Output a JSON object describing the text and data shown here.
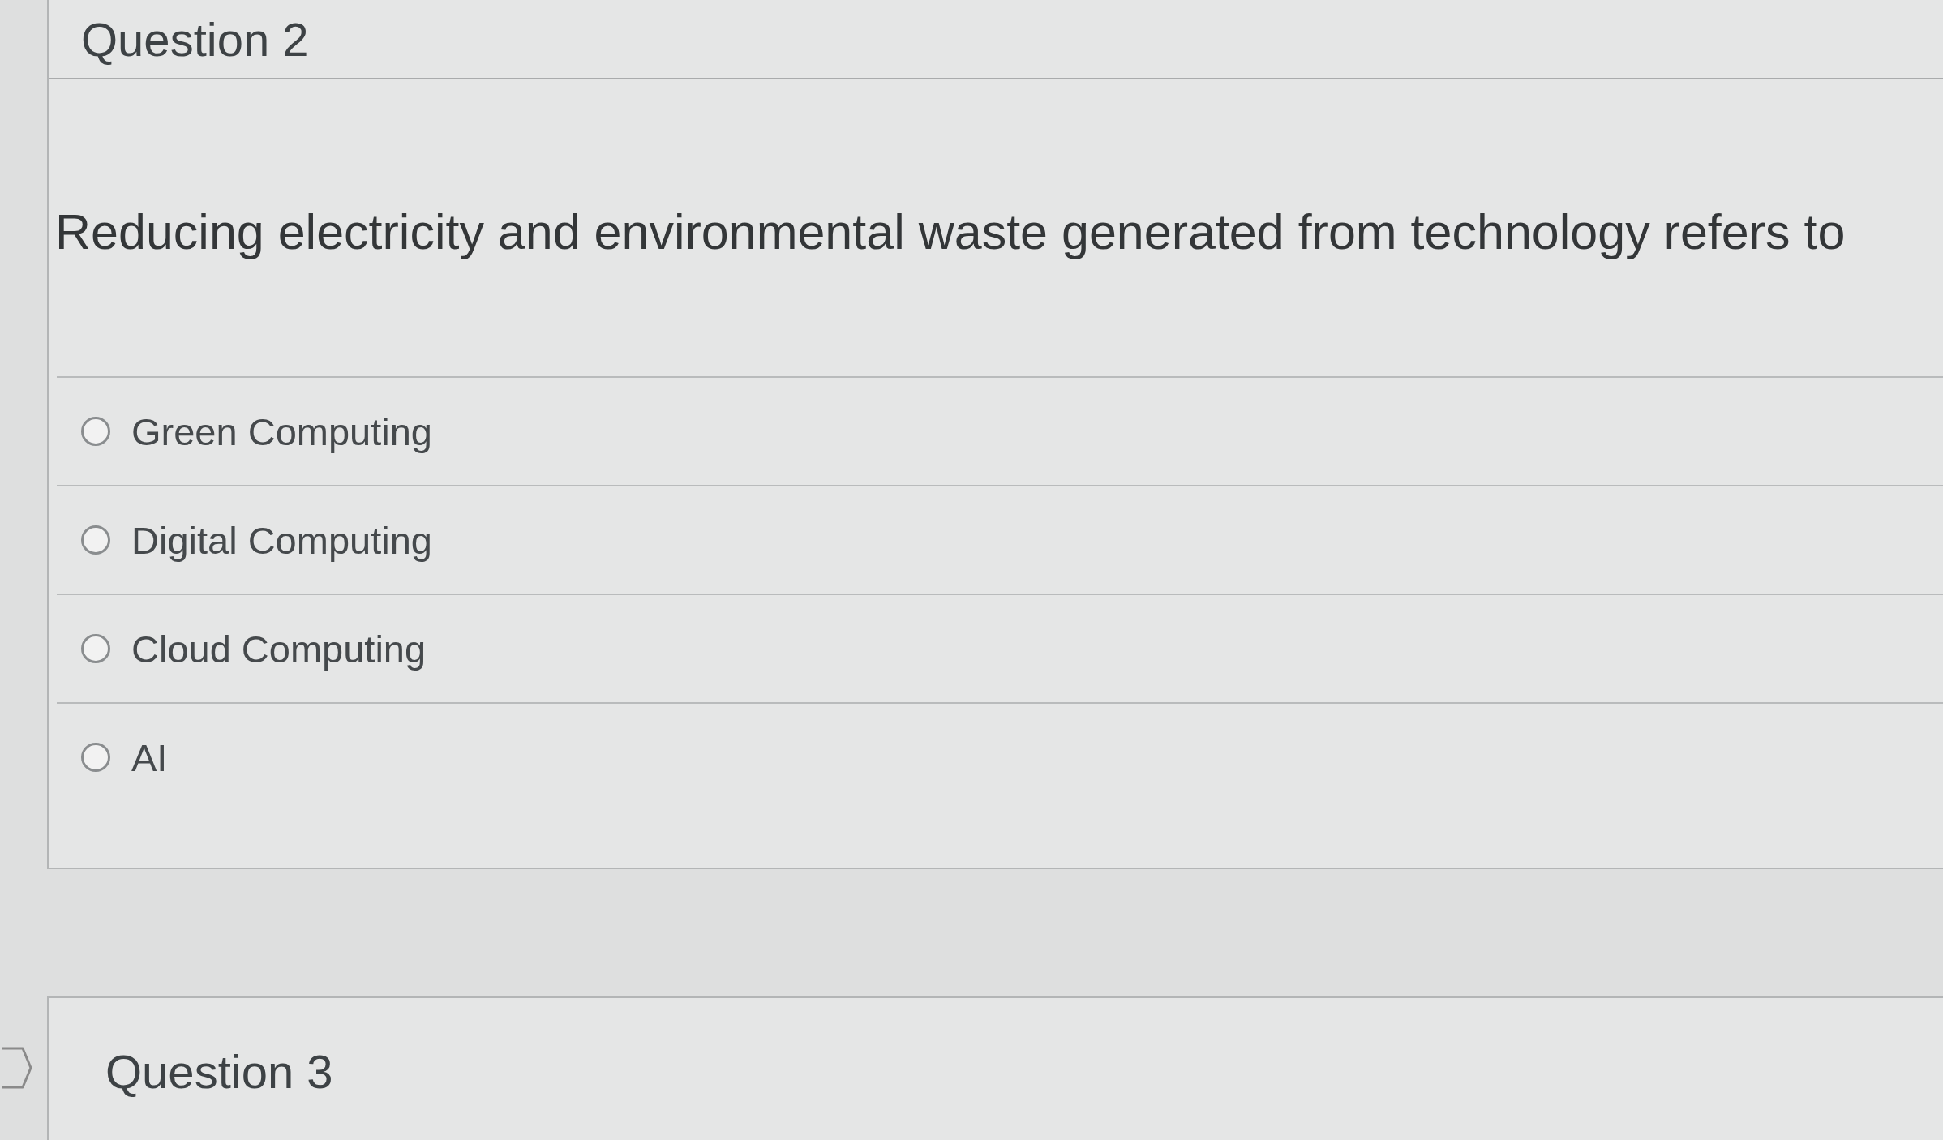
{
  "questions": [
    {
      "title": "Question 2",
      "prompt": "Reducing electricity and environmental waste generated from technology refers to",
      "options": [
        {
          "label": "Green Computing",
          "selected": false
        },
        {
          "label": "Digital Computing",
          "selected": false
        },
        {
          "label": "Cloud Computing",
          "selected": false
        },
        {
          "label": "AI",
          "selected": false
        }
      ]
    },
    {
      "title": "Question 3",
      "flagged": false
    }
  ]
}
